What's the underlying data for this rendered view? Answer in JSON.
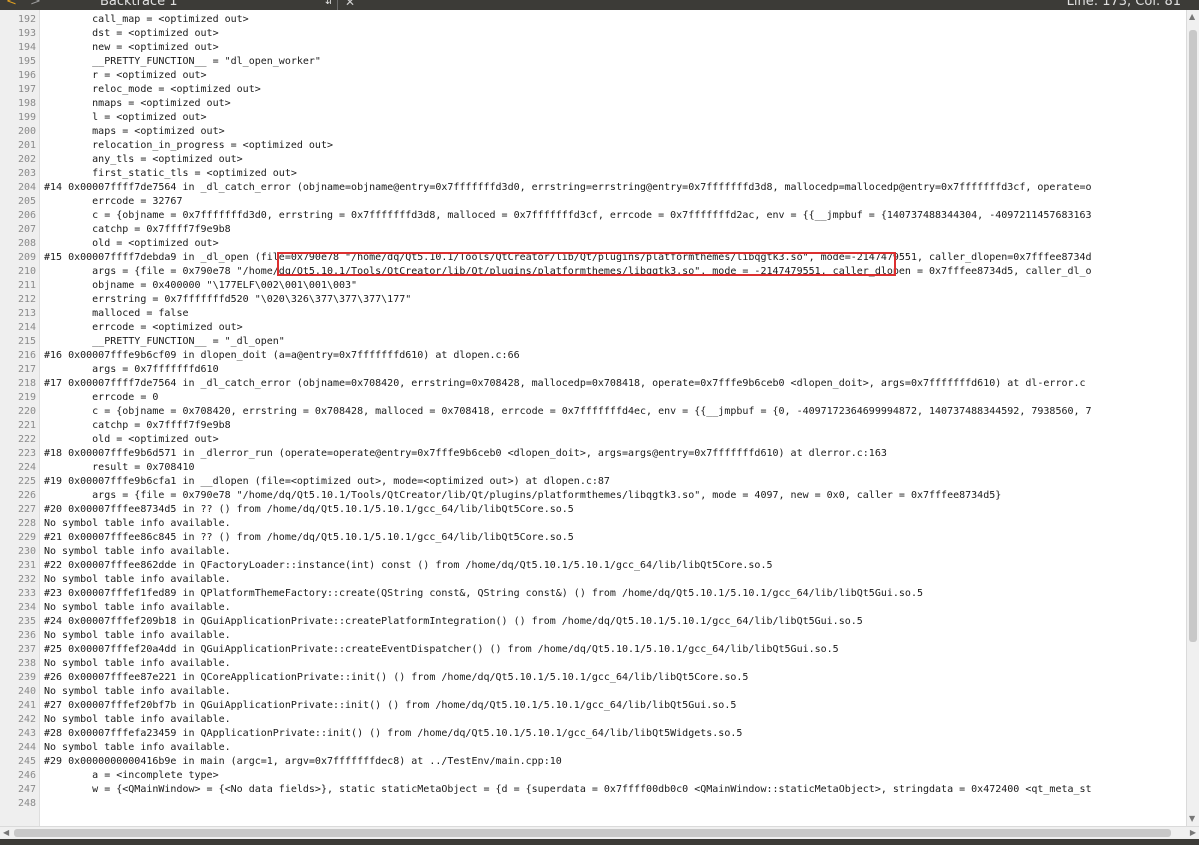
{
  "toolbar": {
    "back_icon": "<",
    "forward_icon": ">",
    "document_title": "Backtrace 1",
    "dropdown_icon": "⇵",
    "close_icon": "✕",
    "line_col": "Line: 173, Col: 81"
  },
  "colors": {
    "toolbar_bg": "#3c3b37",
    "highlight_border": "#dc3030",
    "gutter_bg": "#efefef"
  },
  "scrollbars": {
    "up": "▲",
    "down": "▼",
    "left": "◀",
    "right": "▶"
  },
  "lines": [
    {
      "n": "192",
      "t": "        call_map = <optimized out>"
    },
    {
      "n": "193",
      "t": "        dst = <optimized out>"
    },
    {
      "n": "194",
      "t": "        new = <optimized out>"
    },
    {
      "n": "195",
      "t": "        __PRETTY_FUNCTION__ = \"dl_open_worker\""
    },
    {
      "n": "196",
      "t": "        r = <optimized out>"
    },
    {
      "n": "197",
      "t": "        reloc_mode = <optimized out>"
    },
    {
      "n": "198",
      "t": "        nmaps = <optimized out>"
    },
    {
      "n": "199",
      "t": "        l = <optimized out>"
    },
    {
      "n": "200",
      "t": "        maps = <optimized out>"
    },
    {
      "n": "201",
      "t": "        relocation_in_progress = <optimized out>"
    },
    {
      "n": "202",
      "t": "        any_tls = <optimized out>"
    },
    {
      "n": "203",
      "t": "        first_static_tls = <optimized out>"
    },
    {
      "n": "204",
      "t": "#14 0x00007ffff7de7564 in _dl_catch_error (objname=objname@entry=0x7fffffffd3d0, errstring=errstring@entry=0x7fffffffd3d8, mallocedp=mallocedp@entry=0x7fffffffd3cf, operate=o"
    },
    {
      "n": "205",
      "t": "        errcode = 32767"
    },
    {
      "n": "206",
      "t": "        c = {objname = 0x7fffffffd3d0, errstring = 0x7fffffffd3d8, malloced = 0x7fffffffd3cf, errcode = 0x7fffffffd2ac, env = {{__jmpbuf = {140737488344304, -4097211457683163"
    },
    {
      "n": "207",
      "t": "        catchp = 0x7ffff7f9e9b8"
    },
    {
      "n": "208",
      "t": "        old = <optimized out>"
    },
    {
      "n": "209",
      "t": "#15 0x00007ffff7debda9 in _dl_open (file=0x790e78 \"/home/dq/Qt5.10.1/Tools/QtCreator/lib/Qt/plugins/platformthemes/libqgtk3.so\", mode=-2147479551, caller_dlopen=0x7fffee8734d"
    },
    {
      "n": "210",
      "t": "        args = {file = 0x790e78 \"/home/dq/Qt5.10.1/Tools/QtCreator/lib/Qt/plugins/platformthemes/libqgtk3.so\", mode = -2147479551, caller_dlopen = 0x7fffee8734d5, caller_dl_o"
    },
    {
      "n": "211",
      "t": "        objname = 0x400000 \"\\177ELF\\002\\001\\001\\003\""
    },
    {
      "n": "212",
      "t": "        errstring = 0x7fffffffd520 \"\\020\\326\\377\\377\\377\\177\""
    },
    {
      "n": "213",
      "t": "        malloced = false"
    },
    {
      "n": "214",
      "t": "        errcode = <optimized out>"
    },
    {
      "n": "215",
      "t": "        __PRETTY_FUNCTION__ = \"_dl_open\""
    },
    {
      "n": "216",
      "t": "#16 0x00007fffe9b6cf09 in dlopen_doit (a=a@entry=0x7fffffffd610) at dlopen.c:66"
    },
    {
      "n": "217",
      "t": "        args = 0x7fffffffd610"
    },
    {
      "n": "218",
      "t": "#17 0x00007ffff7de7564 in _dl_catch_error (objname=0x708420, errstring=0x708428, mallocedp=0x708418, operate=0x7fffe9b6ceb0 <dlopen_doit>, args=0x7fffffffd610) at dl-error.c"
    },
    {
      "n": "219",
      "t": "        errcode = 0"
    },
    {
      "n": "220",
      "t": "        c = {objname = 0x708420, errstring = 0x708428, malloced = 0x708418, errcode = 0x7fffffffd4ec, env = {{__jmpbuf = {0, -4097172364699994872, 140737488344592, 7938560, 7"
    },
    {
      "n": "221",
      "t": "        catchp = 0x7ffff7f9e9b8"
    },
    {
      "n": "222",
      "t": "        old = <optimized out>"
    },
    {
      "n": "223",
      "t": "#18 0x00007fffe9b6d571 in _dlerror_run (operate=operate@entry=0x7fffe9b6ceb0 <dlopen_doit>, args=args@entry=0x7fffffffd610) at dlerror.c:163"
    },
    {
      "n": "224",
      "t": "        result = 0x708410"
    },
    {
      "n": "225",
      "t": "#19 0x00007fffe9b6cfa1 in __dlopen (file=<optimized out>, mode=<optimized out>) at dlopen.c:87"
    },
    {
      "n": "226",
      "t": "        args = {file = 0x790e78 \"/home/dq/Qt5.10.1/Tools/QtCreator/lib/Qt/plugins/platformthemes/libqgtk3.so\", mode = 4097, new = 0x0, caller = 0x7fffee8734d5}"
    },
    {
      "n": "227",
      "t": "#20 0x00007fffee8734d5 in ?? () from /home/dq/Qt5.10.1/5.10.1/gcc_64/lib/libQt5Core.so.5"
    },
    {
      "n": "228",
      "t": "No symbol table info available."
    },
    {
      "n": "229",
      "t": "#21 0x00007fffee86c845 in ?? () from /home/dq/Qt5.10.1/5.10.1/gcc_64/lib/libQt5Core.so.5"
    },
    {
      "n": "230",
      "t": "No symbol table info available."
    },
    {
      "n": "231",
      "t": "#22 0x00007fffee862dde in QFactoryLoader::instance(int) const () from /home/dq/Qt5.10.1/5.10.1/gcc_64/lib/libQt5Core.so.5"
    },
    {
      "n": "232",
      "t": "No symbol table info available."
    },
    {
      "n": "233",
      "t": "#23 0x00007fffef1fed89 in QPlatformThemeFactory::create(QString const&, QString const&) () from /home/dq/Qt5.10.1/5.10.1/gcc_64/lib/libQt5Gui.so.5"
    },
    {
      "n": "234",
      "t": "No symbol table info available."
    },
    {
      "n": "235",
      "t": "#24 0x00007fffef209b18 in QGuiApplicationPrivate::createPlatformIntegration() () from /home/dq/Qt5.10.1/5.10.1/gcc_64/lib/libQt5Gui.so.5"
    },
    {
      "n": "236",
      "t": "No symbol table info available."
    },
    {
      "n": "237",
      "t": "#25 0x00007fffef20a4dd in QGuiApplicationPrivate::createEventDispatcher() () from /home/dq/Qt5.10.1/5.10.1/gcc_64/lib/libQt5Gui.so.5"
    },
    {
      "n": "238",
      "t": "No symbol table info available."
    },
    {
      "n": "239",
      "t": "#26 0x00007fffee87e221 in QCoreApplicationPrivate::init() () from /home/dq/Qt5.10.1/5.10.1/gcc_64/lib/libQt5Core.so.5"
    },
    {
      "n": "240",
      "t": "No symbol table info available."
    },
    {
      "n": "241",
      "t": "#27 0x00007fffef20bf7b in QGuiApplicationPrivate::init() () from /home/dq/Qt5.10.1/5.10.1/gcc_64/lib/libQt5Gui.so.5"
    },
    {
      "n": "242",
      "t": "No symbol table info available."
    },
    {
      "n": "243",
      "t": "#28 0x00007fffefa23459 in QApplicationPrivate::init() () from /home/dq/Qt5.10.1/5.10.1/gcc_64/lib/libQt5Widgets.so.5"
    },
    {
      "n": "244",
      "t": "No symbol table info available."
    },
    {
      "n": "245",
      "t": "#29 0x0000000000416b9e in main (argc=1, argv=0x7fffffffdec8) at ../TestEnv/main.cpp:10"
    },
    {
      "n": "246",
      "t": "        a = <incomplete type>"
    },
    {
      "n": "247",
      "t": "        w = {<QMainWindow> = {<No data fields>}, static staticMetaObject = {d = {superdata = 0x7ffff00db0c0 <QMainWindow::staticMetaObject>, stringdata = 0x472400 <qt_meta_st"
    },
    {
      "n": "248",
      "t": ""
    }
  ]
}
